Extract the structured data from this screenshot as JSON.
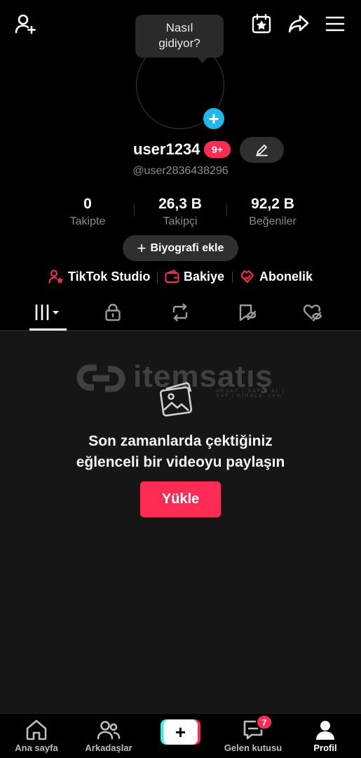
{
  "header": {
    "tooltip": "Nasıl gidiyor?"
  },
  "profile": {
    "username": "user1234",
    "notification_badge": "9+",
    "handle": "@user2836438296"
  },
  "stats": [
    {
      "value": "0",
      "label": "Takipte"
    },
    {
      "value": "26,3 B",
      "label": "Takipçi"
    },
    {
      "value": "92,2 B",
      "label": "Beğeniler"
    }
  ],
  "bio_button": "Biyografi ekle",
  "quick_links": [
    {
      "label": "TikTok Studio",
      "icon": "studio-user-icon"
    },
    {
      "label": "Bakiye",
      "icon": "wallet-icon"
    },
    {
      "label": "Abonelik",
      "icon": "subscription-icon"
    }
  ],
  "tabs": [
    {
      "name": "videos-grid",
      "icon": "grid-icon"
    },
    {
      "name": "private",
      "icon": "lock-icon"
    },
    {
      "name": "reposts",
      "icon": "repost-icon"
    },
    {
      "name": "favorites",
      "icon": "bookmark-icon"
    },
    {
      "name": "liked",
      "icon": "heart-hidden-icon"
    }
  ],
  "watermark": {
    "text": "itemsatış",
    "sub": "HESAP | SATIN AL | SAT | KİRALA .com"
  },
  "empty_state": {
    "line1": "Son zamanlarda çektiğiniz",
    "line2": "eğlenceli bir videoyu paylaşın",
    "button": "Yükle"
  },
  "bottom_nav": {
    "home": "Ana sayfa",
    "friends": "Arkadaşlar",
    "inbox": "Gelen kutusu",
    "inbox_badge": "7",
    "profile": "Profil"
  },
  "colors": {
    "accent": "#fe2c55",
    "cyan": "#25f4ee",
    "avatar_plus": "#20b8e6"
  }
}
